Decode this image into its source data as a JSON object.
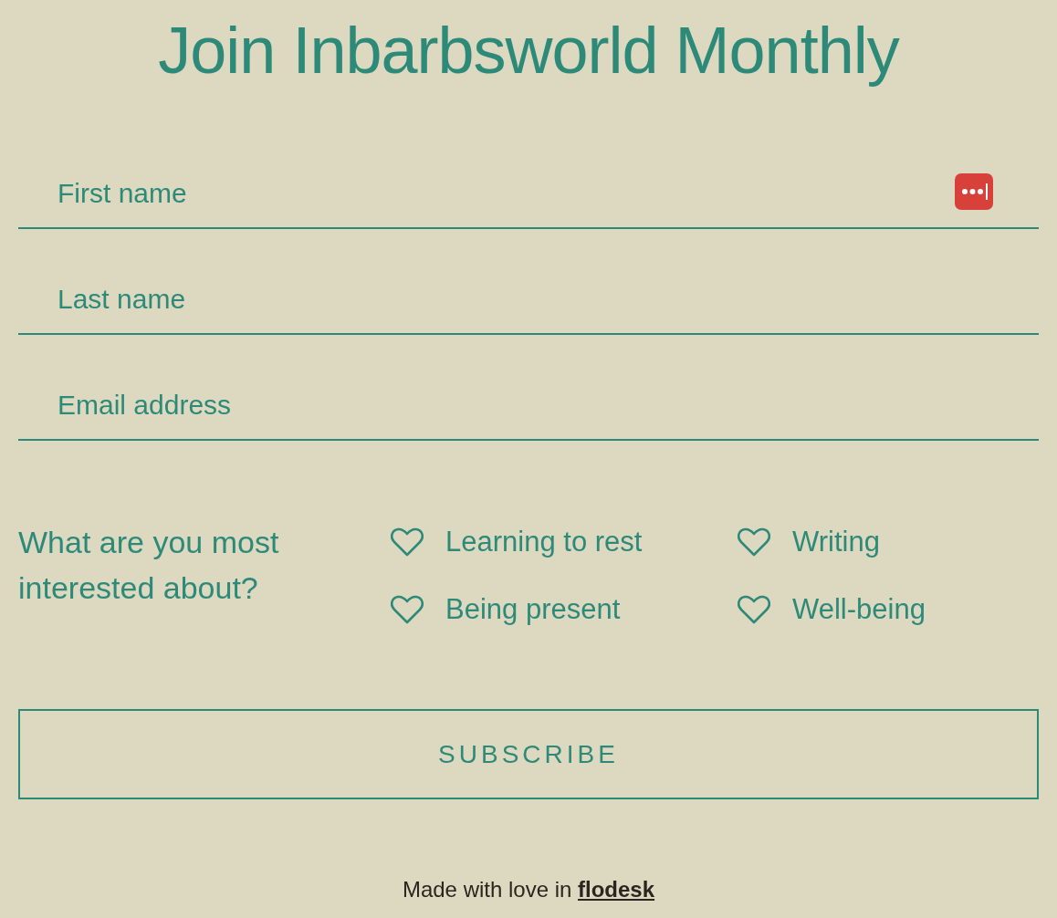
{
  "title": "Join Inbarbsworld Monthly",
  "fields": [
    {
      "placeholder": "First name",
      "password_manager": true
    },
    {
      "placeholder": "Last name",
      "password_manager": false
    },
    {
      "placeholder": "Email address",
      "password_manager": false
    }
  ],
  "interests": {
    "question": "What are you most interested about?",
    "options": [
      {
        "label": "Learning to rest",
        "checked": false
      },
      {
        "label": "Writing",
        "checked": false
      },
      {
        "label": "Being present",
        "checked": false
      },
      {
        "label": "Well-being",
        "checked": false
      }
    ]
  },
  "button": "SUBSCRIBE",
  "footer": {
    "text": "Made with love in",
    "link": "flodesk"
  }
}
